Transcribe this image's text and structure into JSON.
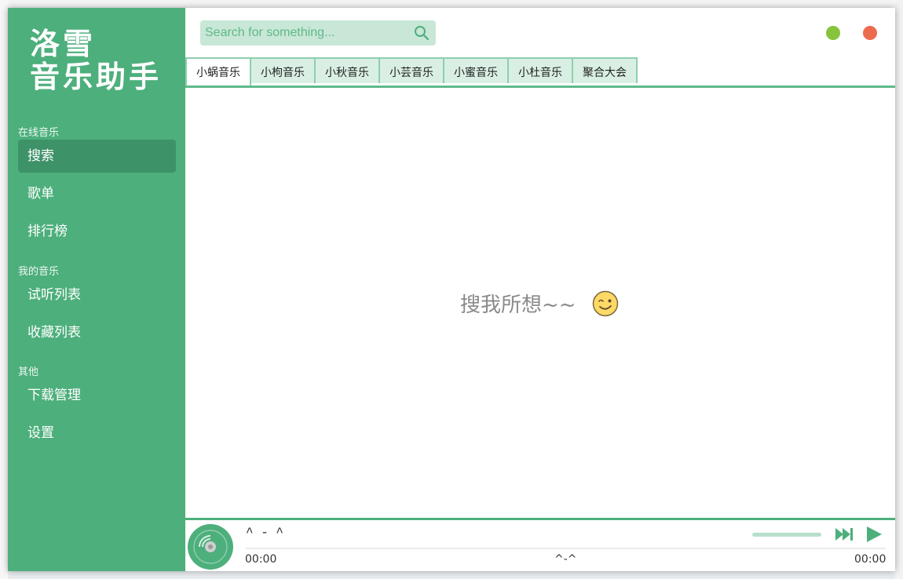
{
  "app": {
    "title_line1": "洛雪",
    "title_line2": "音乐助手"
  },
  "sidebar": {
    "sections": [
      {
        "label": "在线音乐",
        "items": [
          "搜索",
          "歌单",
          "排行榜"
        ]
      },
      {
        "label": "我的音乐",
        "items": [
          "试听列表",
          "收藏列表"
        ]
      },
      {
        "label": "其他",
        "items": [
          "下载管理",
          "设置"
        ]
      }
    ],
    "active_item": "搜索"
  },
  "search": {
    "placeholder": "Search for something...",
    "value": ""
  },
  "tabs": [
    "小蜗音乐",
    "小枸音乐",
    "小秋音乐",
    "小芸音乐",
    "小蜜音乐",
    "小杜音乐",
    "聚合大会"
  ],
  "active_tab": "小蜗音乐",
  "main": {
    "empty_message": "搜我所想~~"
  },
  "player": {
    "title": "^ - ^",
    "current_time": "00:00",
    "total_time": "00:00",
    "middle_text": "^-^",
    "progress": 0,
    "volume": 1.0
  },
  "colors": {
    "primary": "#4daf7c",
    "sidebar_active": "#3e9268",
    "minimize": "#85c43b",
    "close": "#ec6b4f"
  },
  "icons": {
    "search": "search-icon",
    "wink": "wink-emoji-icon",
    "disc": "music-disc-icon",
    "next": "skip-next-icon",
    "play": "play-icon"
  }
}
